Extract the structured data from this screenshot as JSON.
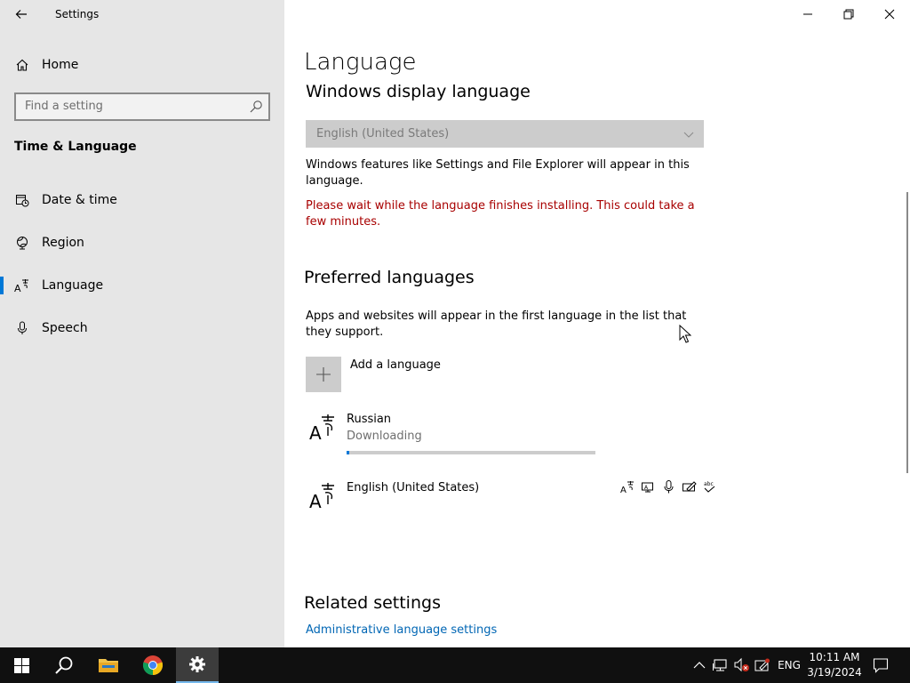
{
  "window": {
    "title": "Settings"
  },
  "sidebar": {
    "home_label": "Home",
    "search_placeholder": "Find a setting",
    "section_title": "Time & Language",
    "items": [
      {
        "label": "Date & time",
        "icon": "calendar-clock-icon"
      },
      {
        "label": "Region",
        "icon": "globe-icon"
      },
      {
        "label": "Language",
        "icon": "language-icon",
        "active": true
      },
      {
        "label": "Speech",
        "icon": "microphone-icon"
      }
    ]
  },
  "main": {
    "page_title": "Language",
    "display_language": {
      "heading": "Windows display language",
      "dropdown_value": "English (United States)",
      "description": "Windows features like Settings and File Explorer will appear in this language.",
      "warning": "Please wait while the language finishes installing. This could take a few minutes."
    },
    "preferred": {
      "heading": "Preferred languages",
      "description": "Apps and websites will appear in the first language in the list that they support.",
      "add_label": "Add a language",
      "languages": [
        {
          "name": "Russian",
          "status": "Downloading",
          "progress": 0.01
        },
        {
          "name": "English (United States)",
          "features": [
            "language-pack-icon",
            "display-icon",
            "speech-icon",
            "handwriting-icon",
            "spellcheck-icon"
          ]
        }
      ]
    },
    "related": {
      "heading": "Related settings",
      "link": "Administrative language settings"
    }
  },
  "taskbar": {
    "lang_indicator": "ENG",
    "time": "10:11 AM",
    "date": "3/19/2024"
  },
  "colors": {
    "accent": "#0078d7",
    "warning": "#a80000",
    "link": "#0066b4",
    "sidebar_bg": "#e6e6e6",
    "taskbar_bg": "#101010"
  }
}
